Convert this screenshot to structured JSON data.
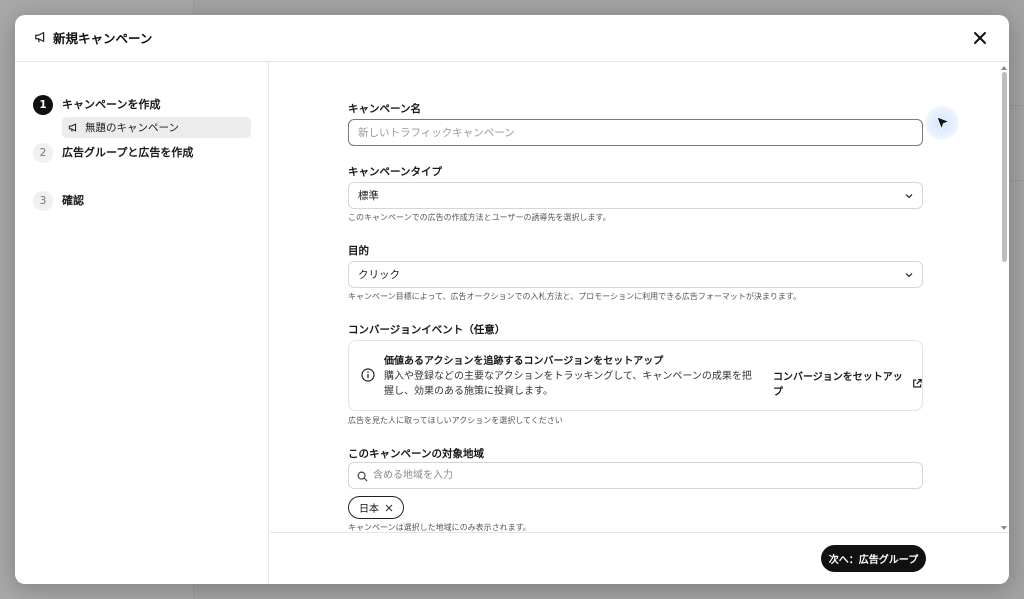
{
  "modal": {
    "title": "新規キャンペーン"
  },
  "steps": [
    {
      "number": "1",
      "label": "キャンペーンを作成"
    },
    {
      "number": "2",
      "label": "広告グループと広告を作成"
    },
    {
      "number": "3",
      "label": "確認"
    }
  ],
  "substep": {
    "label": "無題のキャンペーン"
  },
  "form": {
    "campaign_name": {
      "label": "キャンペーン名",
      "placeholder": "新しいトラフィックキャンペーン",
      "value": ""
    },
    "campaign_type": {
      "label": "キャンペーンタイプ",
      "value": "標準",
      "help": "このキャンペーンでの広告の作成方法とユーザーの誘導先を選択します。"
    },
    "objective": {
      "label": "目的",
      "value": "クリック",
      "help": "キャンペーン目標によって、広告オークションでの入札方法と、プロモーションに利用できる広告フォーマットが決まります。"
    },
    "conversion": {
      "label": "コンバージョンイベント（任意）",
      "card_title": "価値あるアクションを追跡するコンバージョンをセットアップ",
      "card_body": "購入や登録などの主要なアクションをトラッキングして、キャンペーンの成果を把握し、効果のある施策に投資します。",
      "link_label": "コンバージョンをセットアップ",
      "help": "広告を見た人に取ってほしいアクションを選択してください"
    },
    "location": {
      "label": "このキャンペーンの対象地域",
      "placeholder": "含める地域を入力",
      "chips": [
        "日本"
      ],
      "help": "キャンペーンは選択した地域にのみ表示されます。"
    }
  },
  "footer": {
    "next_label": "次へ：広告グループ"
  },
  "colors": {
    "primary_button": "#111111",
    "overlay": "#a3a3a3"
  }
}
